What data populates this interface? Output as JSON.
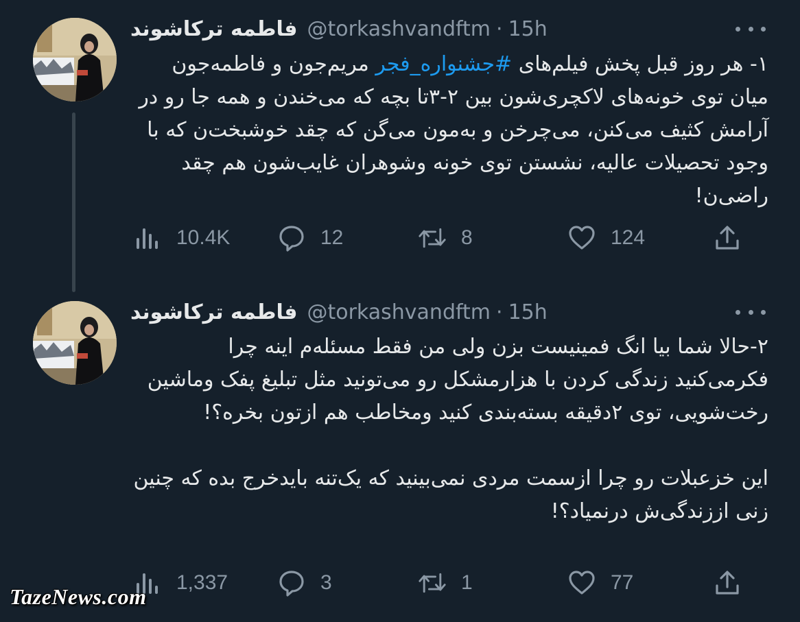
{
  "tweets": [
    {
      "author": "فاطمه ترکاشوند",
      "handle": "@torkashvandftm",
      "separator": "·",
      "time": "15h",
      "text_before": "۱- هر روز قبل پخش فیلم‌های ",
      "hashtag": "#جشنواره_فجر",
      "text_after": " مریم‌جون و فاطمه‌جون میان توی خونه‌های لاکچری‌شون بین ۲-۳تا بچه که می‌خندن و همه جا رو در آرامش کثیف می‌کنن، می‌چرخن و به‌مون می‌گن که چقد خوشبخت‌ن که با وجود تحصیلات عالیه، نشستن توی خونه وشوهران غایب‌شون هم چقد راضی‌ن!",
      "views": "10.4K",
      "replies": "12",
      "retweets": "8",
      "likes": "124"
    },
    {
      "author": "فاطمه ترکاشوند",
      "handle": "@torkashvandftm",
      "separator": "·",
      "time": "15h",
      "text": "۲-حالا شما بیا انگ فمینیست بزن ولی من فقط مسئله‌م اینه چرا فکرمی‌کنید زندگی کردن با هزارمشکل رو می‌تونید مثل تبلیغ پفک وماشین رخت‌شویی، توی ۲دقیقه بسته‌بندی کنید ومخاطب هم ازتون بخره؟!\n\nاین خزعبلات رو چرا ازسمت مردی نمی‌بینید که یک‌تنه بایدخرج بده که چنین زنی اززندگی‌ش درنمیاد؟!",
      "views": "1,337",
      "replies": "3",
      "retweets": "1",
      "likes": "77"
    }
  ],
  "watermark": "TazeNews.com",
  "icons": {
    "views": "bar-chart-icon",
    "reply": "reply-bubble-icon",
    "retweet": "retweet-icon",
    "like": "heart-icon",
    "share": "share-icon",
    "more": "more-dots-icon"
  },
  "colors": {
    "background": "#15202b",
    "text": "#e7e9ea",
    "secondary": "#8b98a5",
    "accent": "#1d9bf0"
  }
}
